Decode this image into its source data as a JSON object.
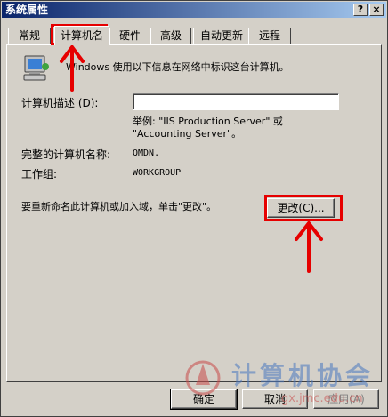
{
  "window": {
    "title": "系统属性",
    "help_btn": "?",
    "close_btn": "×"
  },
  "tabs": [
    {
      "label": "常规"
    },
    {
      "label": "计算机名"
    },
    {
      "label": "硬件"
    },
    {
      "label": "高级"
    },
    {
      "label": "自动更新"
    },
    {
      "label": "远程"
    }
  ],
  "panel": {
    "info_text": "Windows 使用以下信息在网络中标识这台计算机。",
    "description_label": "计算机描述 (D):",
    "description_value": "",
    "example_line1": "举例: \"IIS Production Server\" 或",
    "example_line2": "\"Accounting Server\"。",
    "full_name_label": "完整的计算机名称:",
    "full_name_value": "QMDN.",
    "workgroup_label": "工作组:",
    "workgroup_value": "WORKGROUP",
    "rename_text": "要重新命名此计算机或加入域，单击\"更改\"。",
    "change_button": "更改(C)..."
  },
  "footer": {
    "ok": "确定",
    "cancel": "取消",
    "apply": "应用(A)"
  },
  "watermark": {
    "text": "计算机协会",
    "url": "gx.jmc.edu.cn"
  },
  "colors": {
    "annotation": "#e60000",
    "titlebar": "#0a246a",
    "face": "#d4d0c8"
  }
}
